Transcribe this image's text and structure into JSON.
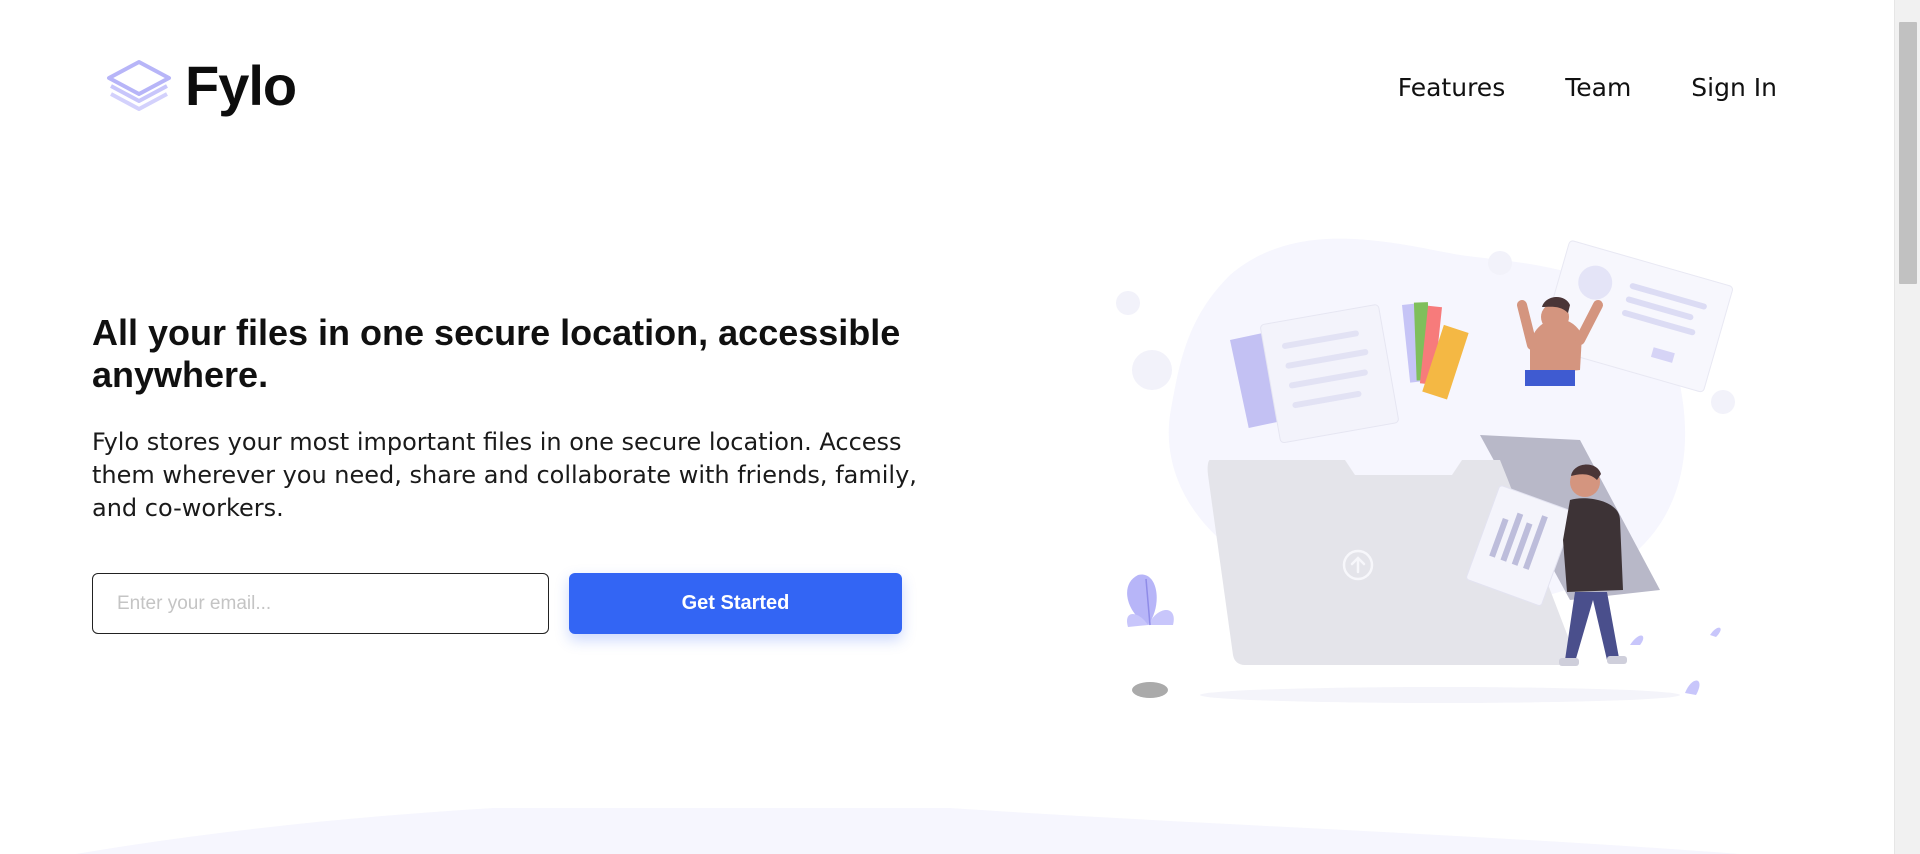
{
  "brand": {
    "name": "Fylo"
  },
  "nav": {
    "features": "Features",
    "team": "Team",
    "sign_in": "Sign In"
  },
  "hero": {
    "title": "All your files in one secure location, accessible anywhere.",
    "description": "Fylo stores your most important files in one secure location. Access them wherever you need, share and collaborate with friends, family, and co-workers."
  },
  "form": {
    "email_placeholder": "Enter your email...",
    "email_value": "",
    "cta_label": "Get Started"
  },
  "icons": {
    "logo": "layers-icon",
    "illustration": "file-upload-illustration",
    "upload": "upload-icon"
  },
  "colors": {
    "accent": "#3365f4",
    "logo_lavender": "#c8c6fb",
    "illustration_blob": "#f6f6fe"
  }
}
